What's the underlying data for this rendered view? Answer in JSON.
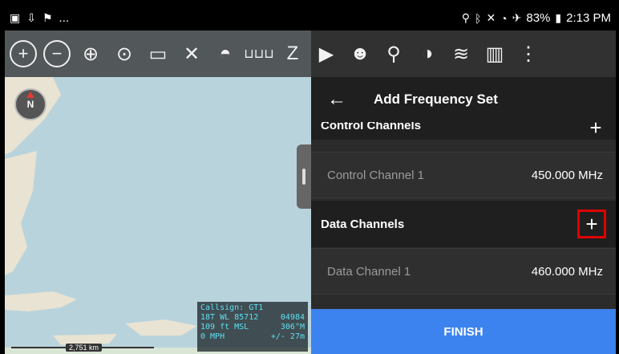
{
  "statusbar": {
    "left_icons": [
      "image-icon",
      "download-icon",
      "flag-icon"
    ],
    "ellipsis": "...",
    "battery": "83%",
    "time": "2:13 PM"
  },
  "toolbar": {
    "icons": [
      "zoom-in-icon",
      "zoom-out-icon",
      "locate-icon",
      "lock-icon",
      "frame-icon",
      "close-cross-icon",
      "sail-icon",
      "ruler-icon",
      "measure-icon",
      "play-icon",
      "team-icon",
      "add-place-icon",
      "add-overlay-icon",
      "layers-icon",
      "map-icon",
      "more-vertical-icon"
    ]
  },
  "compass": {
    "label": "N"
  },
  "readout": {
    "callsign": "Callsign: GT1",
    "grid_a": "18T  WL  85712",
    "grid_b": "04984",
    "elev": "109 ft MSL",
    "heading": "306°M",
    "speed": "0 MPH",
    "accuracy": "+/- 27m"
  },
  "scale": {
    "label": "2,751 km"
  },
  "panel": {
    "title": "Add Frequency Set",
    "control_section": "Control Channels",
    "control_items": [
      {
        "name": "Control Channel 1",
        "value": "450.000 MHz"
      }
    ],
    "data_section": "Data Channels",
    "data_items": [
      {
        "name": "Data Channel 1",
        "value": "460.000 MHz"
      }
    ],
    "finish": "FINISH"
  },
  "colors": {
    "accent": "#3d83ef",
    "highlight": "#e00000",
    "readout_text": "#5de0f0"
  }
}
